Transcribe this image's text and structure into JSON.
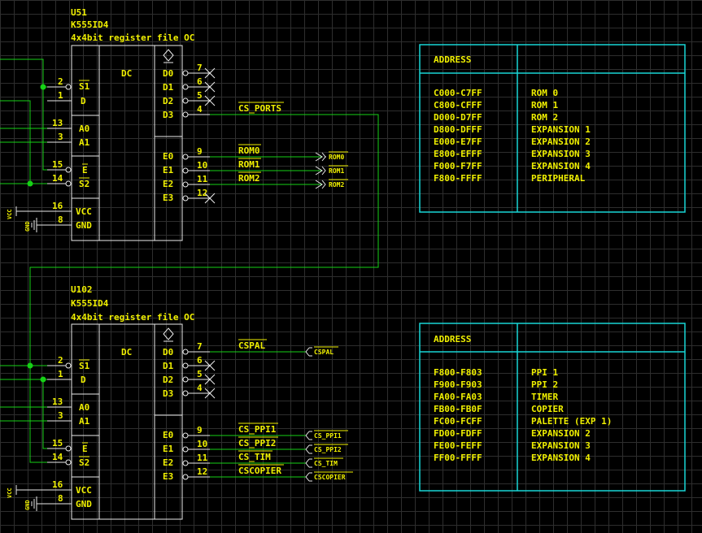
{
  "u51": {
    "ref": "U51",
    "part": "K555ID4",
    "desc": "4x4bit register file OC",
    "dc": "DC",
    "in_labels": [
      "S1",
      "D",
      "A0",
      "A1",
      "E",
      "S2",
      "VCC",
      "GND"
    ],
    "in_pins": [
      "2",
      "1",
      "13",
      "3",
      "15",
      "14",
      "16",
      "8"
    ],
    "out_labels": [
      "D0",
      "D1",
      "D2",
      "D3",
      "E0",
      "E1",
      "E2",
      "E3"
    ],
    "out_pins": [
      "7",
      "6",
      "5",
      "4",
      "9",
      "10",
      "11",
      "12"
    ],
    "nets": [
      "CS_PORTS",
      "ROM0",
      "ROM1",
      "ROM2"
    ],
    "ports": [
      "ROM0",
      "ROM1",
      "ROM2"
    ],
    "power": [
      "VCC",
      "GND"
    ]
  },
  "u102": {
    "ref": "U102",
    "part": "K555ID4",
    "desc": "4x4bit register file OC",
    "dc": "DC",
    "in_labels": [
      "S1",
      "D",
      "A0",
      "A1",
      "E",
      "S2",
      "VCC",
      "GND"
    ],
    "in_pins": [
      "2",
      "1",
      "13",
      "3",
      "15",
      "14",
      "16",
      "8"
    ],
    "out_labels": [
      "D0",
      "D1",
      "D2",
      "D3",
      "E0",
      "E1",
      "E2",
      "E3"
    ],
    "out_pins": [
      "7",
      "6",
      "5",
      "4",
      "9",
      "10",
      "11",
      "12"
    ],
    "nets": [
      "CSPAL",
      "CS_PPI1",
      "CS_PPI2",
      "CS_TIM",
      "CSCOPIER"
    ],
    "ports": [
      "CSPAL",
      "CS_PPI1",
      "CS_PPI2",
      "CS_TIM",
      "CSCOPIER"
    ],
    "power": [
      "VCC",
      "GND"
    ]
  },
  "table1": {
    "header": "ADDRESS",
    "rows": [
      [
        "C000-C7FF",
        "ROM 0"
      ],
      [
        "C800-CFFF",
        "ROM 1"
      ],
      [
        "D000-D7FF",
        "ROM 2"
      ],
      [
        "D800-DFFF",
        "EXPANSION 1"
      ],
      [
        "E000-E7FF",
        "EXPANSION 2"
      ],
      [
        "E800-EFFF",
        "EXPANSION 3"
      ],
      [
        "F000-F7FF",
        "EXPANSION 4"
      ],
      [
        "F800-FFFF",
        "PERIPHERAL"
      ]
    ]
  },
  "table2": {
    "header": "ADDRESS",
    "rows": [
      [
        "F800-F803",
        "PPI 1"
      ],
      [
        "F900-F903",
        "PPI 2"
      ],
      [
        "FA00-FA03",
        "TIMER"
      ],
      [
        "FB00-FB0F",
        "COPIER"
      ],
      [
        "FC00-FCFF",
        "PALETTE (EXP 1)"
      ],
      [
        "FD00-FDFF",
        "EXPANSION 2"
      ],
      [
        "FE00-FEFF",
        "EXPANSION 3"
      ],
      [
        "FF00-FFFF",
        "EXPANSION 4"
      ]
    ]
  },
  "colors": {
    "wire": "#16d116",
    "text": "#f0f000",
    "component": "#eaeaea",
    "table": "#19d6d6",
    "grid": "#2e2e2e"
  }
}
